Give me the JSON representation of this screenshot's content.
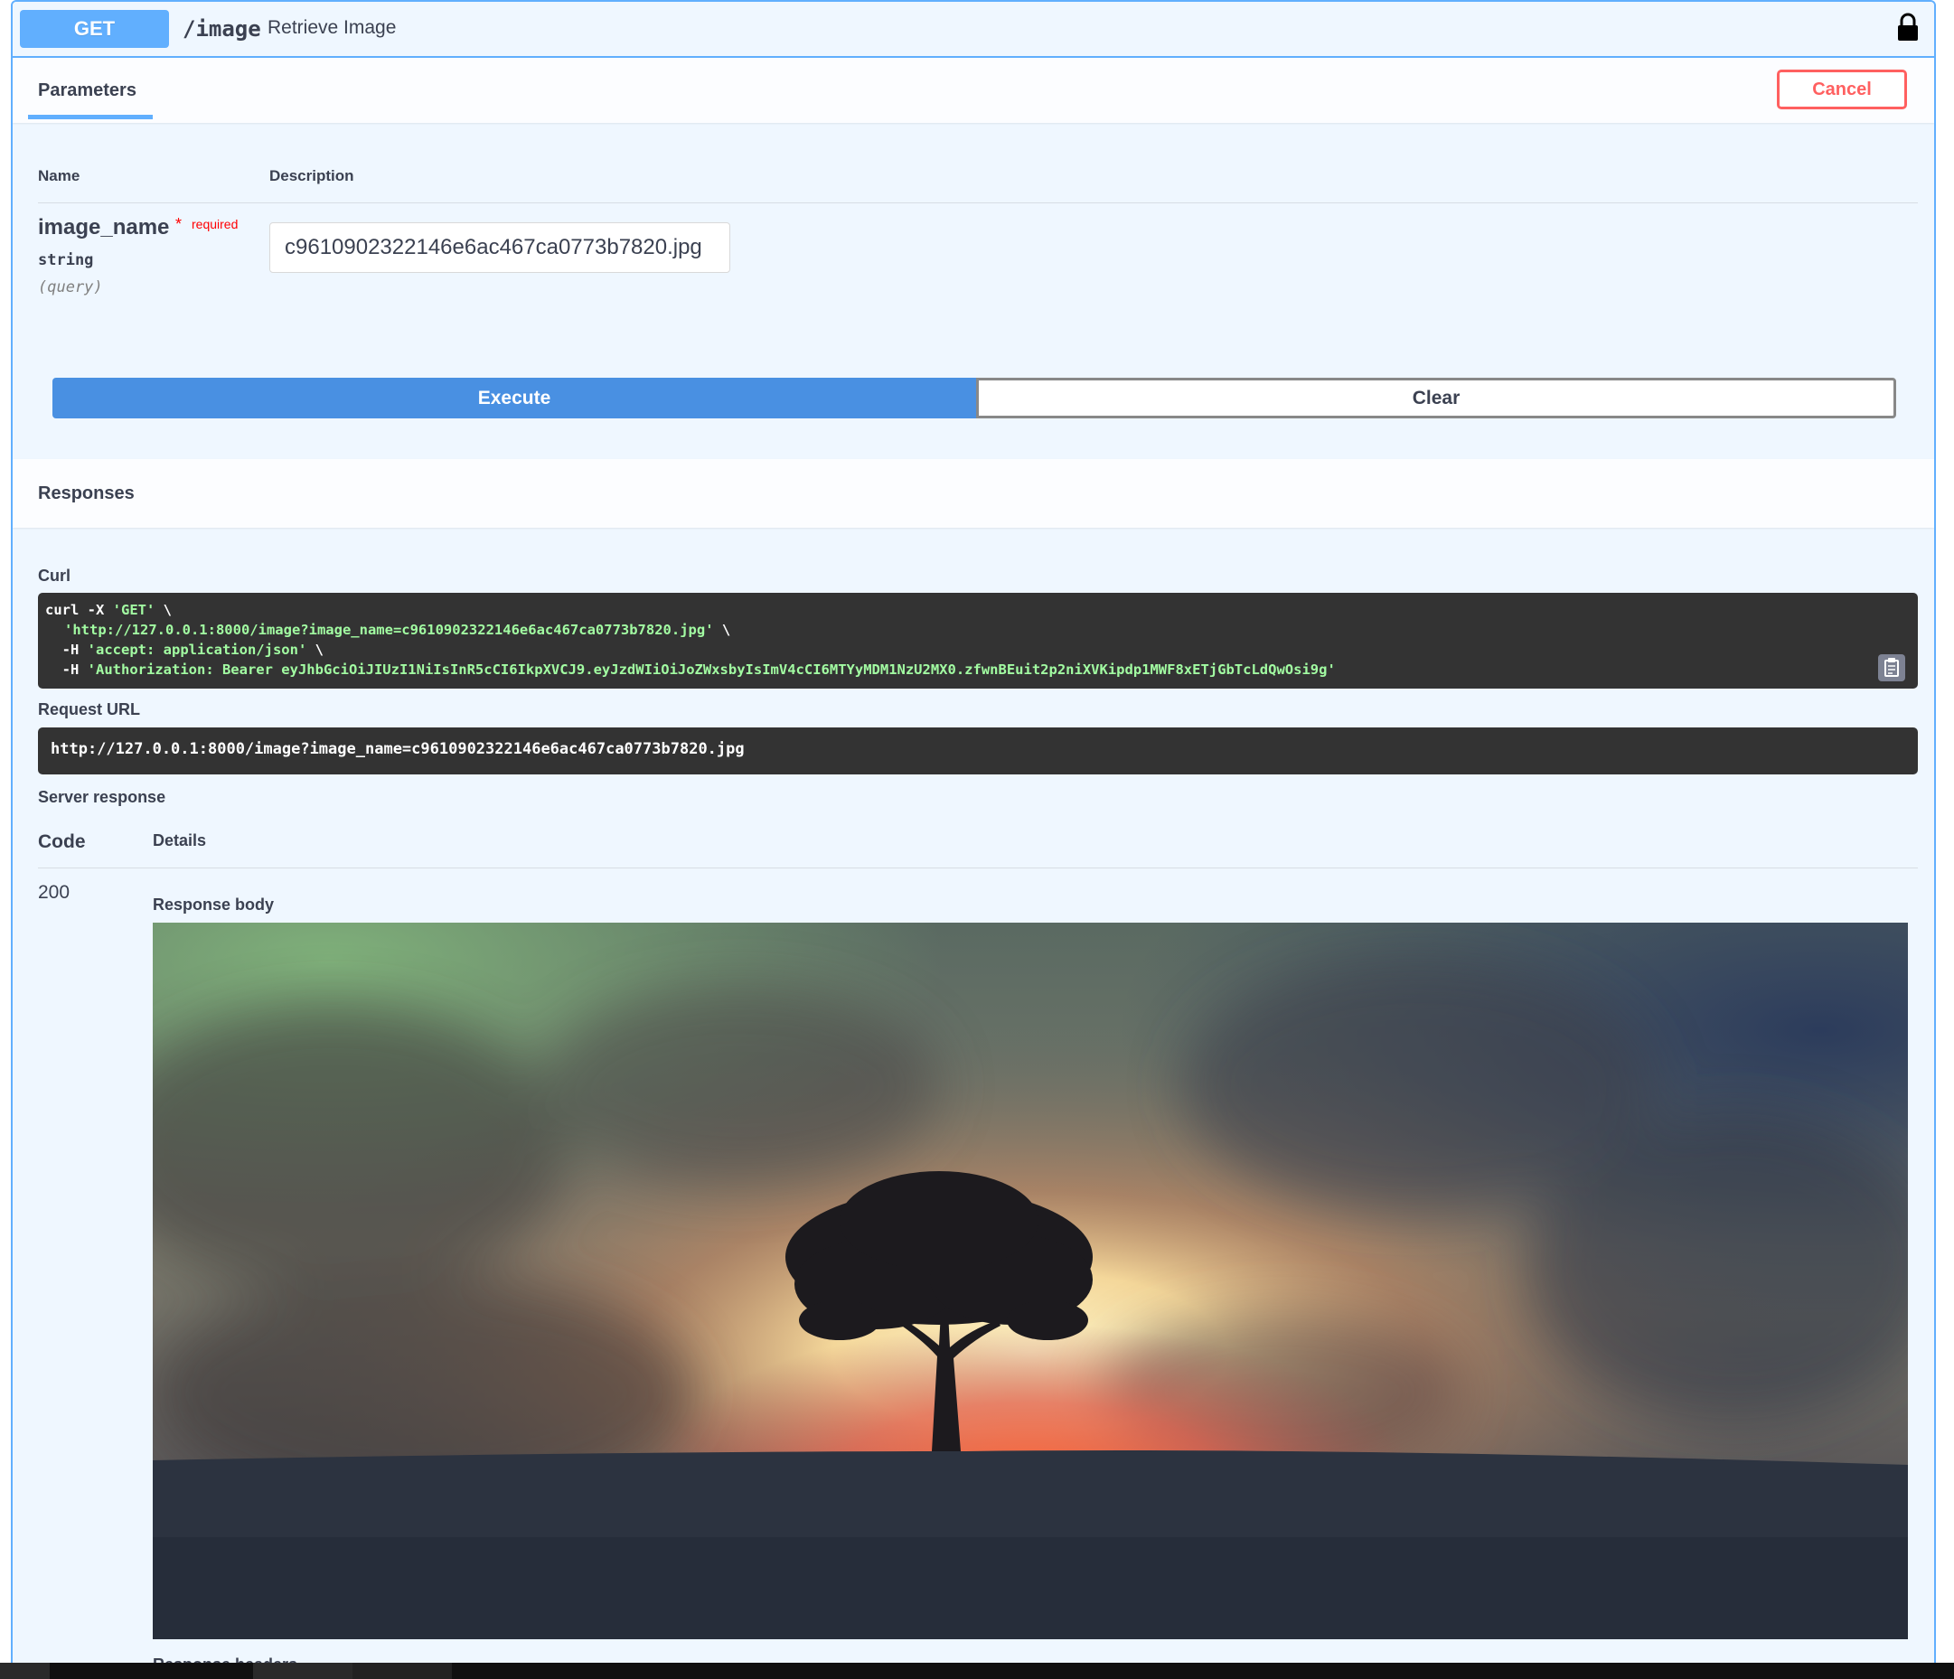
{
  "endpoint": {
    "method": "GET",
    "path": "/image",
    "summary": "Retrieve Image"
  },
  "parameters": {
    "tab_label": "Parameters",
    "cancel_label": "Cancel",
    "col_name": "Name",
    "col_description": "Description",
    "items": [
      {
        "name": "image_name",
        "required_star": "*",
        "required_label": "required",
        "type": "string",
        "in": "(query)",
        "value": "c9610902322146e6ac467ca0773b7820.jpg"
      }
    ]
  },
  "actions": {
    "execute_label": "Execute",
    "clear_label": "Clear"
  },
  "responses": {
    "title": "Responses",
    "curl_label": "Curl",
    "curl": {
      "line1_cmd": "curl -X ",
      "line1_str": "'GET'",
      "line1_tail": " \\",
      "line2_str": "'http://127.0.0.1:8000/image?image_name=c9610902322146e6ac467ca0773b7820.jpg'",
      "line2_tail": " \\",
      "line3_flag": "  -H ",
      "line3_str": "'accept: application/json'",
      "line3_tail": " \\",
      "line4_flag": "  -H ",
      "line4_str": "'Authorization: Bearer eyJhbGciOiJIUzI1NiIsInR5cCI6IkpXVCJ9.eyJzdWIiOiJoZWxsbyIsImV4cCI6MTYyMDM1NzU2MX0.zfwnBEuit2p2niXVKipdp1MWF8xETjGbTcLdQwOsi9g'"
    },
    "request_url_label": "Request URL",
    "request_url": "http://127.0.0.1:8000/image?image_name=c9610902322146e6ac467ca0773b7820.jpg",
    "server_response_label": "Server response",
    "code_header": "Code",
    "details_header": "Details",
    "status_code": "200",
    "response_body_label": "Response body",
    "response_headers_label": "Response headers"
  },
  "icons": {
    "lock": "lock-icon",
    "copy": "clipboard-icon"
  },
  "colors": {
    "get_accent": "#61affe",
    "execute": "#4990e2",
    "cancel": "#ff6060",
    "code_bg": "#333333",
    "code_string": "#a2fca2"
  }
}
